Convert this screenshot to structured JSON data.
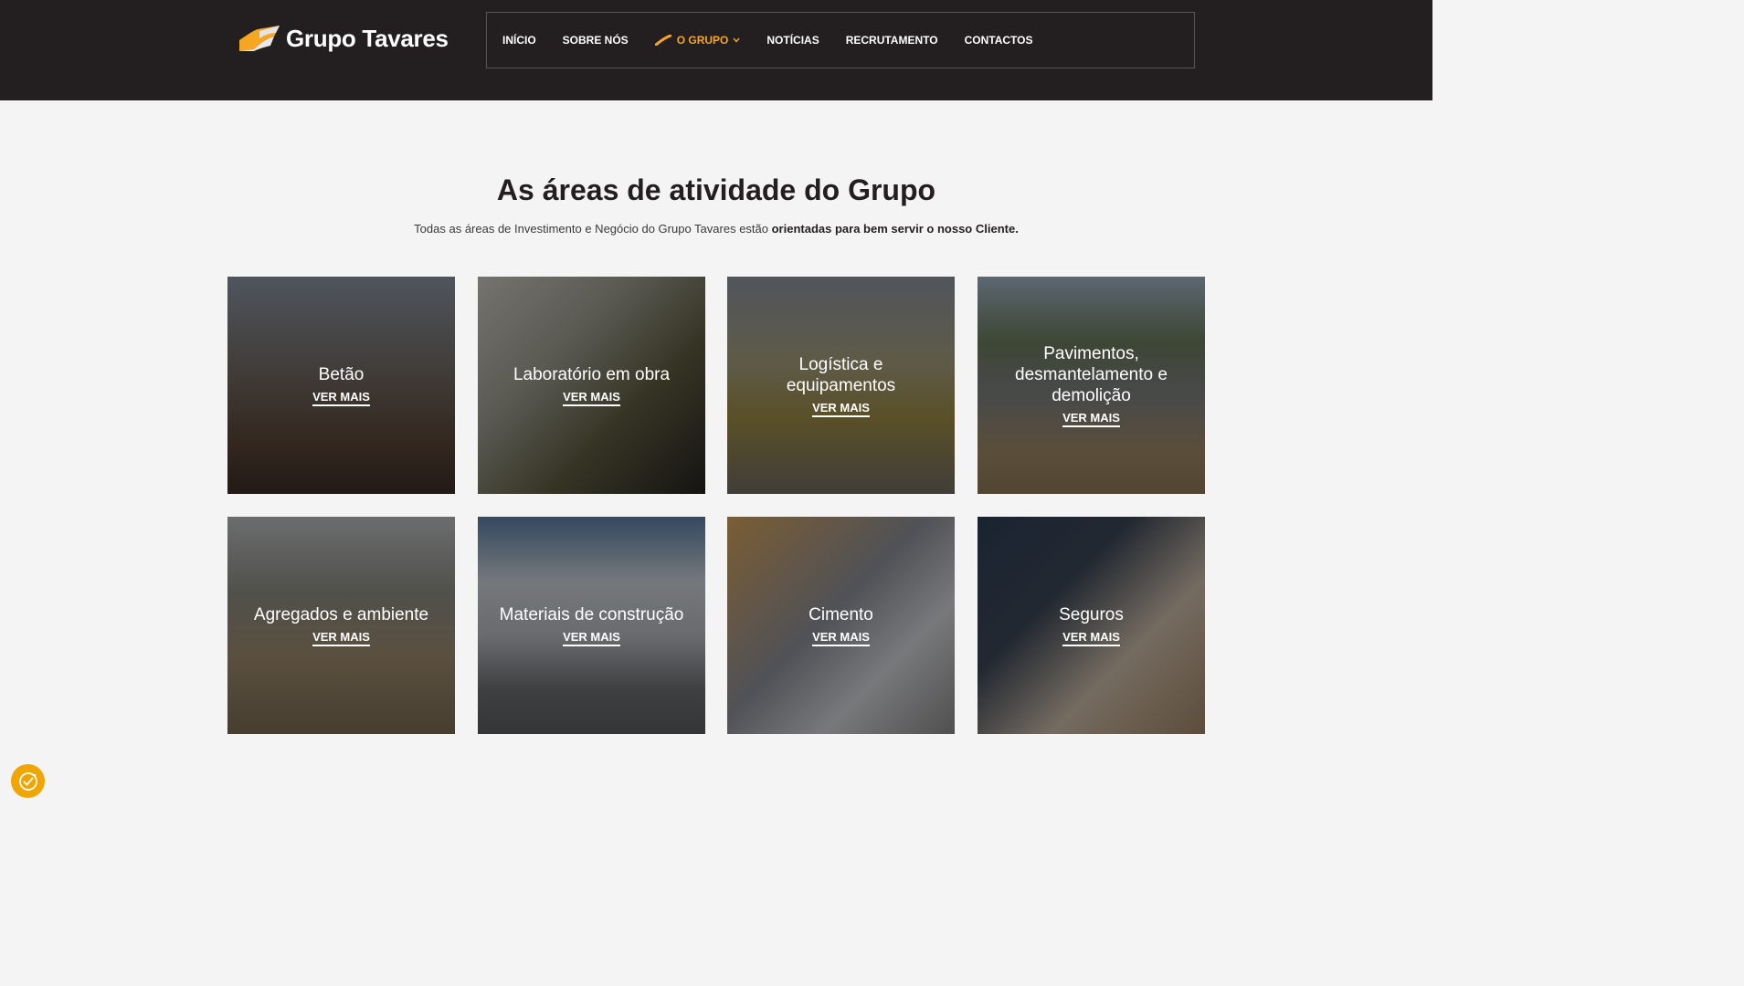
{
  "brand": {
    "name": "Grupo Tavares",
    "accent": "#f5a623",
    "dark": "#231f20"
  },
  "nav": {
    "items": [
      {
        "label": "INÍCIO"
      },
      {
        "label": "SOBRE NÓS"
      },
      {
        "label": "O GRUPO",
        "active": true,
        "icon": "chevron-down-icon"
      },
      {
        "label": "NOTÍCIAS"
      },
      {
        "label": "RECRUTAMENTO"
      },
      {
        "label": "CONTACTOS"
      }
    ]
  },
  "section": {
    "title": "As áreas de atividade do Grupo",
    "subtitle_plain": "Todas as áreas de Investimento e Negócio do Grupo Tavares estão ",
    "subtitle_bold": "orientadas para bem servir o nosso Cliente."
  },
  "cards": [
    {
      "title": "Betão",
      "link": "VER MAIS"
    },
    {
      "title": "Laboratório em obra",
      "link": "VER MAIS"
    },
    {
      "title": "Logística e equipamentos",
      "link": "VER MAIS"
    },
    {
      "title": "Pavimentos, desmantelamento e demolição",
      "link": "VER MAIS"
    },
    {
      "title": "Agregados e ambiente",
      "link": "VER MAIS"
    },
    {
      "title": "Materiais de construção",
      "link": "VER MAIS"
    },
    {
      "title": "Cimento",
      "link": "VER MAIS"
    },
    {
      "title": "Seguros",
      "link": "VER MAIS"
    }
  ],
  "cookie_button": {
    "icon": "cookie-settings-icon",
    "color": "#f0a500"
  }
}
